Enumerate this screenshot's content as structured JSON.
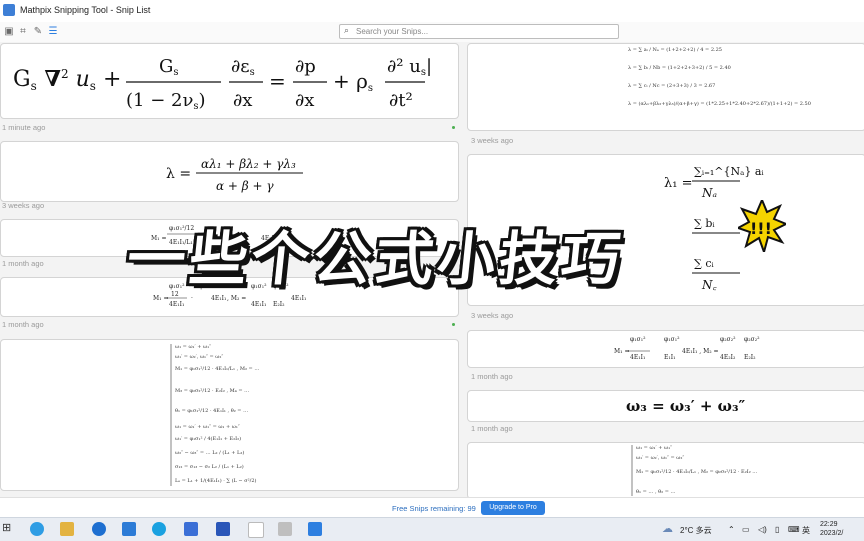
{
  "window": {
    "title": "Mathpix Snipping Tool - Snip List"
  },
  "search": {
    "placeholder": "Search your Snips..."
  },
  "cards": {
    "c1_time": "1 minute ago",
    "c2_time": "3 weeks ago",
    "c3_time": "1 month ago",
    "c4_time": "1 month ago",
    "r1_time": "3 weeks ago",
    "r2_time": "3 weeks ago",
    "r3_time": "1 month ago",
    "r4_time": "1 month ago",
    "c2_formula_lhs": "λ =",
    "c2_formula_num": "αλ₁ + βλ₂ + γλ₃",
    "c2_formula_den": "α + β + γ",
    "r2_formula_lhs": "λ₁ =",
    "r2_formula_num": "∑ᵢ₌₁^{Nₐ} aᵢ",
    "r2_formula_den": "Nₐ",
    "r3b_formula": "ω₃ = ω₃′ + ω₃″",
    "r1_lines": [
      "λ = ∑ aᵢ / Nₐ = (1+2+2+2) / 4 = 2.25",
      "λ = ∑ bᵢ / Nb = (1+2+2+3+2) / 5 = 2.40",
      "λ = ∑ cᵢ / Nc = (2+3+3) / 3 = 2.67",
      "λ = (αλ₁+βλ₂+γλ₃)/(α+β+γ) = (1*2.25+1*2.40+2*2.67)/(1+1+2) = 2.50"
    ]
  },
  "overlay": {
    "text": "一些个公式小技巧",
    "exclaim": "!!!"
  },
  "footer": {
    "free_text": "Free Snips remaining: 99",
    "upgrade_label": "Upgrade to Pro"
  },
  "taskbar": {
    "weather": "2°C  多云",
    "lang": "英",
    "time": "22:29",
    "date": "2023/2/"
  },
  "colors": {
    "accent": "#2d7fe0",
    "overlay_text": "#ffffff",
    "overlay_outline": "#111111",
    "burst": "#f5d400"
  }
}
